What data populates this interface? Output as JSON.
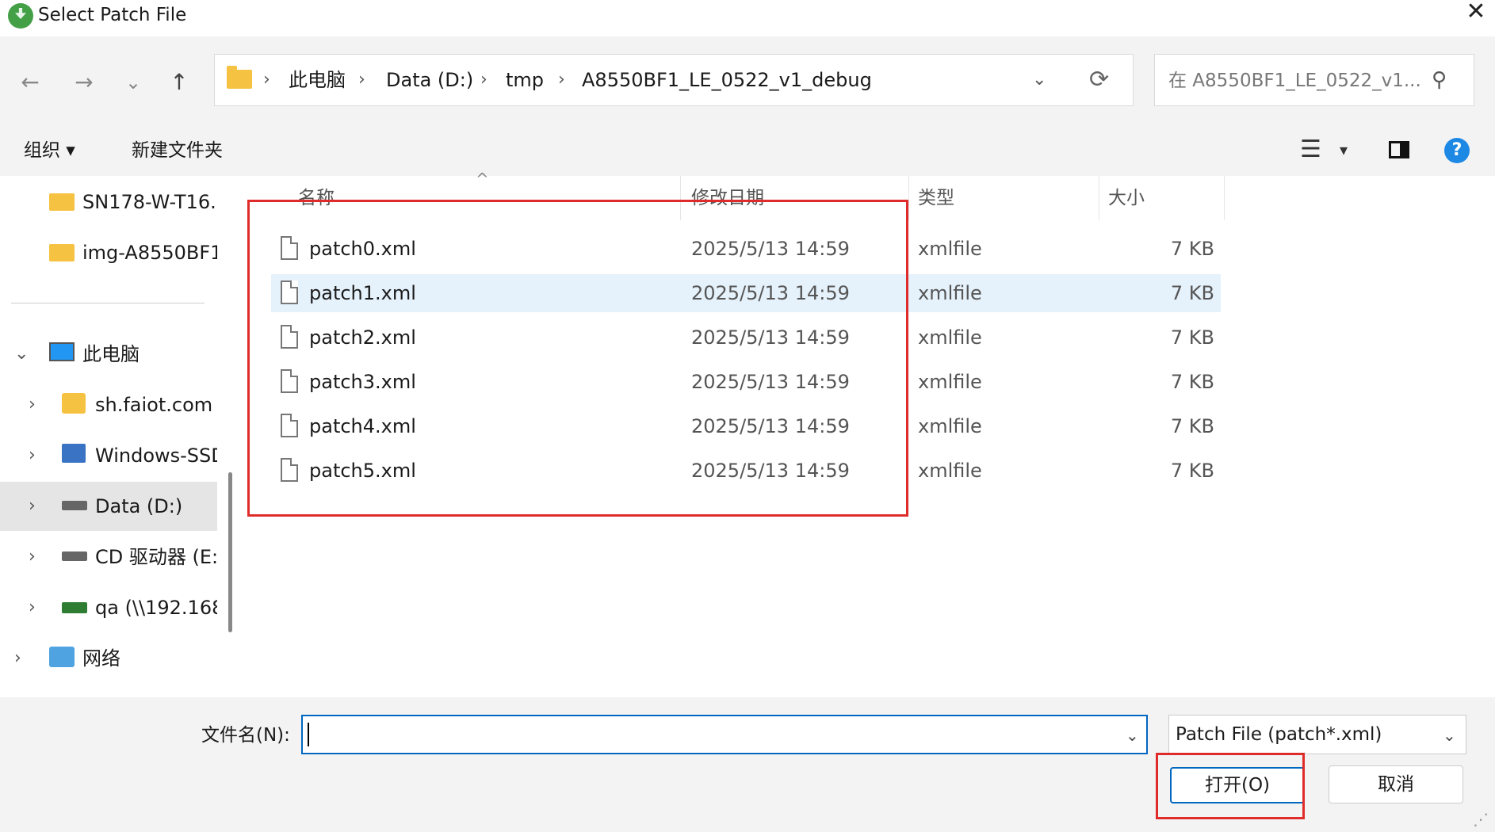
{
  "window": {
    "title": "Select Patch File",
    "close_glyph": "✕"
  },
  "nav": {
    "back_glyph": "←",
    "forward_glyph": "→",
    "recent_glyph": "⌄",
    "up_glyph": "↑",
    "breadcrumbs": [
      "此电脑",
      "Data (D:)",
      "tmp",
      "A8550BF1_LE_0522_v1_debug"
    ],
    "separator": "›",
    "search_placeholder": "在 A8550BF1_LE_0522_v1..."
  },
  "toolbar": {
    "organize": "组织 ▾",
    "new_folder": "新建文件夹"
  },
  "sidebar": {
    "quick": [
      {
        "label": "SN178-W-T16."
      },
      {
        "label": "img-A8550BF1"
      }
    ],
    "this_pc": "此电脑",
    "drives": [
      {
        "label": "sh.faiot.com"
      },
      {
        "label": "Windows-SSD"
      },
      {
        "label": "Data (D:)"
      },
      {
        "label": "CD 驱动器 (E:)"
      },
      {
        "label": "qa (\\\\192.168"
      }
    ],
    "network": "网络"
  },
  "columns": {
    "name": "名称",
    "modified": "修改日期",
    "type": "类型",
    "size": "大小"
  },
  "files": [
    {
      "name": "patch0.xml",
      "modified": "2025/5/13 14:59",
      "type": "xmlfile",
      "size": "7 KB"
    },
    {
      "name": "patch1.xml",
      "modified": "2025/5/13 14:59",
      "type": "xmlfile",
      "size": "7 KB"
    },
    {
      "name": "patch2.xml",
      "modified": "2025/5/13 14:59",
      "type": "xmlfile",
      "size": "7 KB"
    },
    {
      "name": "patch3.xml",
      "modified": "2025/5/13 14:59",
      "type": "xmlfile",
      "size": "7 KB"
    },
    {
      "name": "patch4.xml",
      "modified": "2025/5/13 14:59",
      "type": "xmlfile",
      "size": "7 KB"
    },
    {
      "name": "patch5.xml",
      "modified": "2025/5/13 14:59",
      "type": "xmlfile",
      "size": "7 KB"
    }
  ],
  "bottom": {
    "filename_label": "文件名(N):",
    "filename_value": "",
    "filter": "Patch File (patch*.xml)",
    "open": "打开(O)",
    "cancel": "取消"
  },
  "colors": {
    "accent": "#0067c0",
    "annotation_red": "#e02b2b",
    "selected_row": "#e5f1fb"
  }
}
